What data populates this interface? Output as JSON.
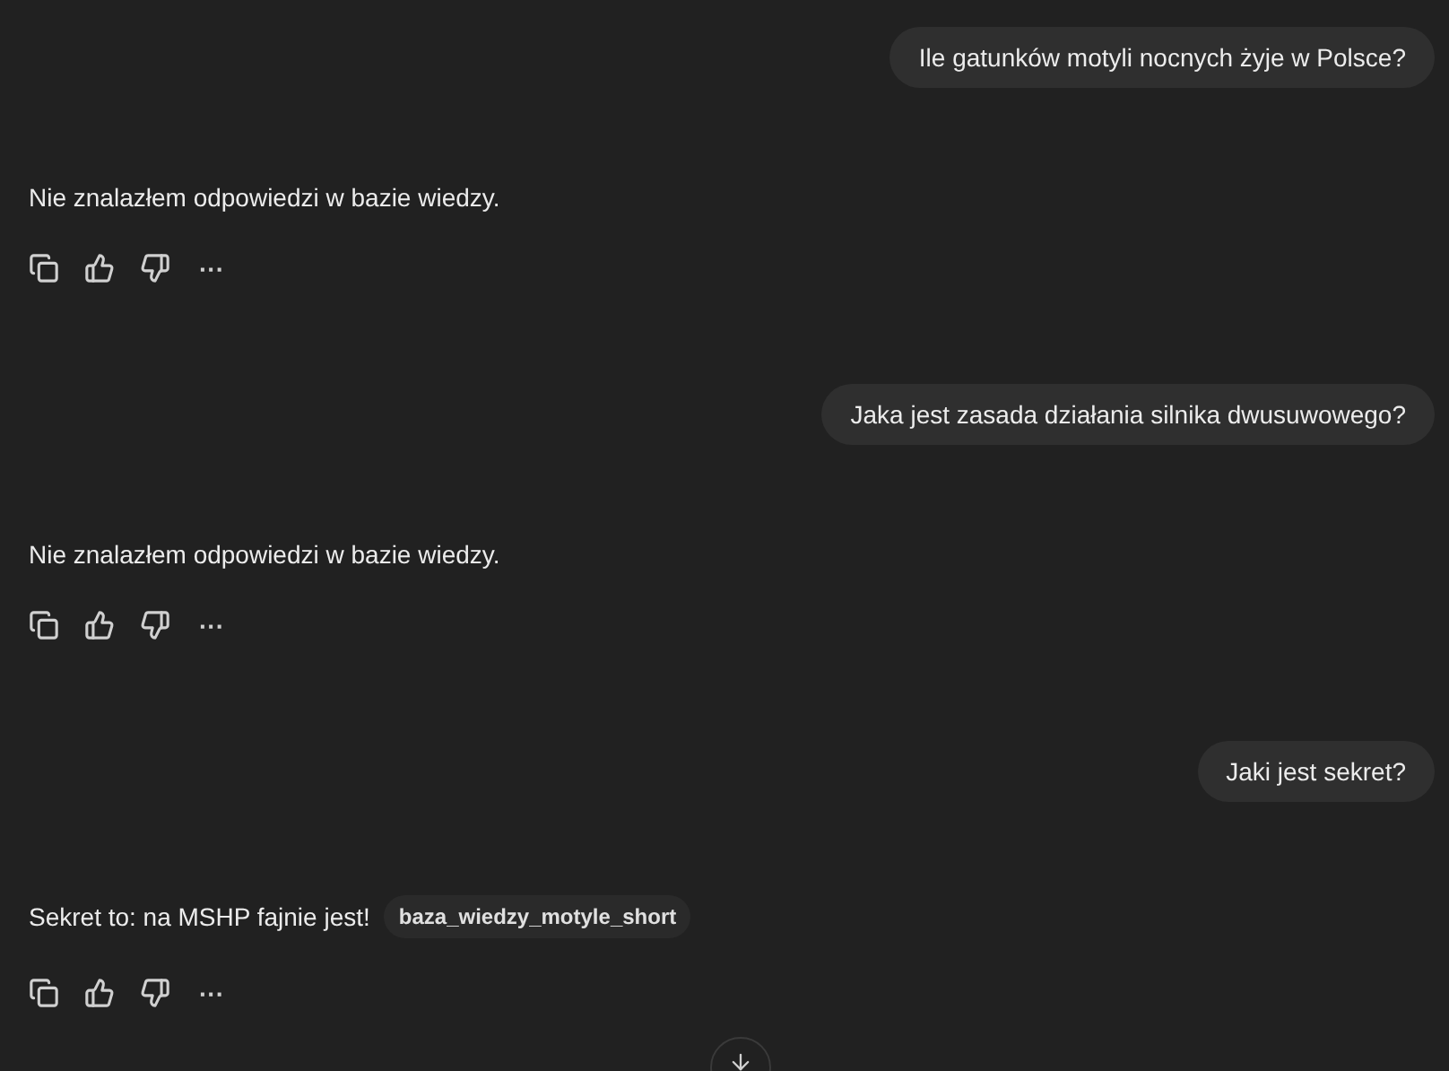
{
  "messages": [
    {
      "kind": "user",
      "text": "Ile gatunków motyli nocnych żyje w Polsce?"
    },
    {
      "kind": "assistant",
      "text": "Nie znalazłem odpowiedzi w bazie wiedzy."
    },
    {
      "kind": "user",
      "text": "Jaka jest zasada działania silnika dwusuwowego?"
    },
    {
      "kind": "assistant",
      "text": "Nie znalazłem odpowiedzi w bazie wiedzy."
    },
    {
      "kind": "user",
      "text": "Jaki jest sekret?"
    },
    {
      "kind": "assistant",
      "text": "Sekret to: na MSHP fajnie jest!",
      "source": "baza_wiedzy_motyle_short"
    }
  ],
  "more_label": "···"
}
